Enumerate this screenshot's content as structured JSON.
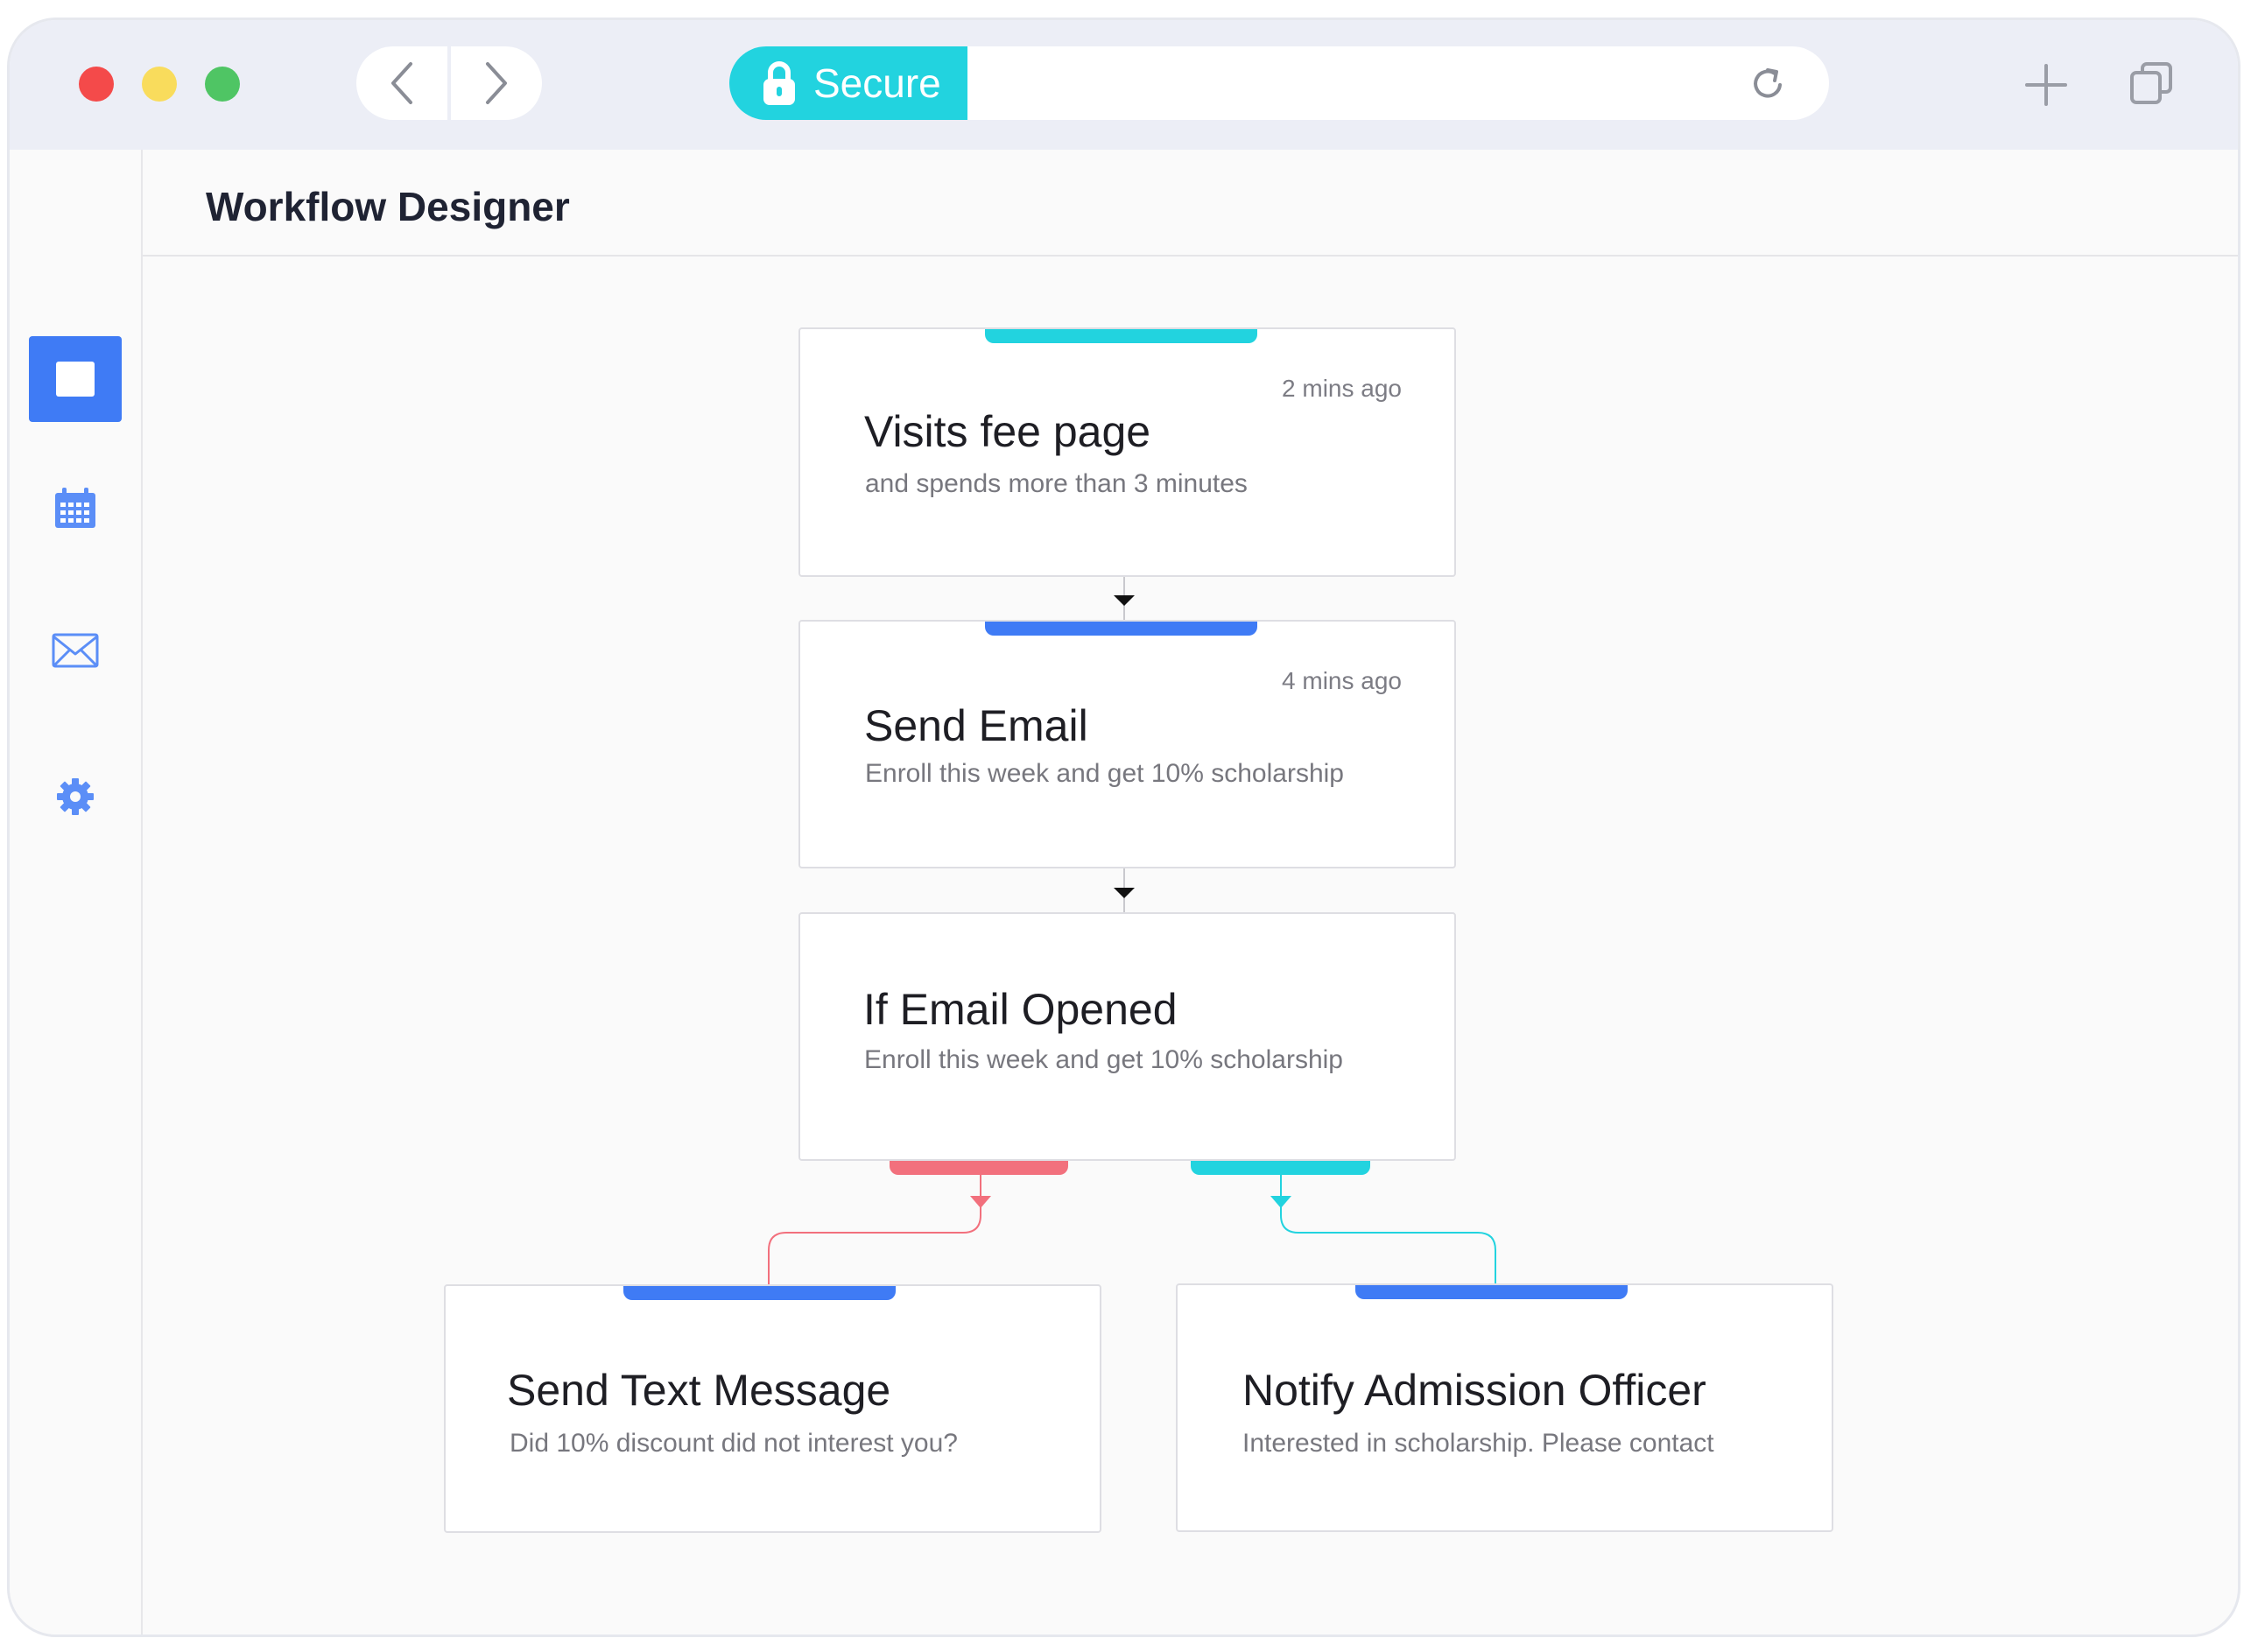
{
  "browser": {
    "secure_label": "Secure",
    "icons": {
      "back": "chevron-left-icon",
      "forward": "chevron-right-icon",
      "lock": "lock-icon",
      "reload": "reload-icon",
      "new_tab": "plus-icon",
      "tabs": "tabs-icon"
    }
  },
  "sidebar": {
    "items": [
      {
        "icon": "dashboard-icon",
        "active": true
      },
      {
        "icon": "calendar-icon",
        "active": false
      },
      {
        "icon": "mail-icon",
        "active": false
      },
      {
        "icon": "gear-icon",
        "active": false
      }
    ]
  },
  "header": {
    "title": "Workflow Designer"
  },
  "workflow": {
    "nodes": [
      {
        "title": "Visits fee page",
        "subtitle": "and spends more than 3 minutes",
        "time": "2 mins ago",
        "accent": "#22d3df"
      },
      {
        "title": "Send Email",
        "subtitle": "Enroll this week and get 10% scholarship",
        "time": "4 mins ago",
        "accent": "#3f7bf5"
      },
      {
        "title": "If Email Opened",
        "subtitle": "Enroll this week and get 10% scholarship",
        "time": "",
        "accent": ""
      },
      {
        "title": "Send Text Message",
        "subtitle": "Did 10% discount did not interest you?",
        "time": "",
        "accent": "#3f7bf5"
      },
      {
        "title": "Notify Admission Officer",
        "subtitle": "Interested in scholarship. Please contact",
        "time": "",
        "accent": "#3f7bf5"
      }
    ],
    "branch_colors": {
      "no": "#f2707d",
      "yes": "#22d3df"
    }
  }
}
